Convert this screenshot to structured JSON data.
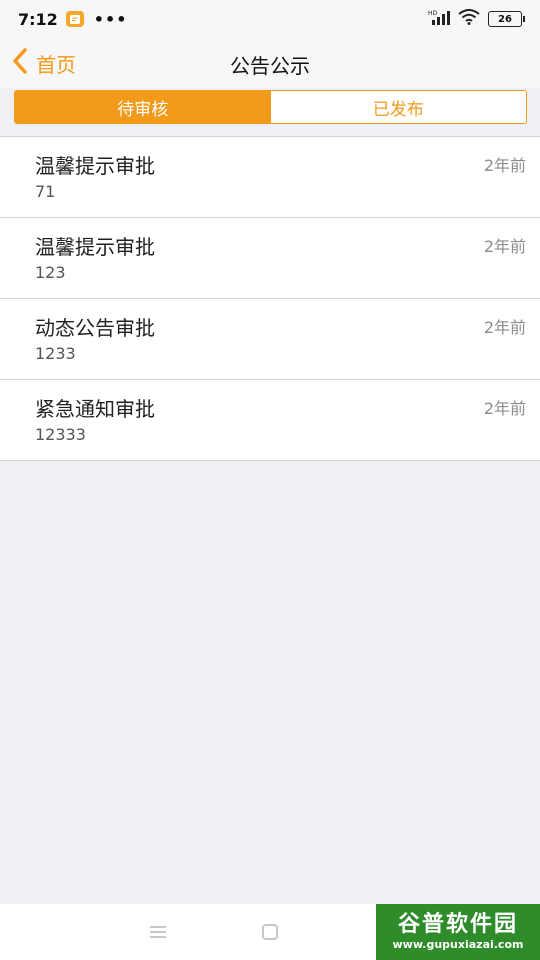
{
  "status_bar": {
    "time": "7:12",
    "dots": "•••",
    "battery": "26"
  },
  "nav": {
    "back_label": "首页",
    "title": "公告公示"
  },
  "tabs": [
    {
      "label": "待审核",
      "active": true
    },
    {
      "label": "已发布",
      "active": false
    }
  ],
  "items": [
    {
      "title": "温馨提示审批",
      "subtitle": "71",
      "time": "2年前"
    },
    {
      "title": "温馨提示审批",
      "subtitle": "123",
      "time": "2年前"
    },
    {
      "title": "动态公告审批",
      "subtitle": "1233",
      "time": "2年前"
    },
    {
      "title": "紧急通知审批",
      "subtitle": "12333",
      "time": "2年前"
    }
  ],
  "watermark": {
    "title": "谷普软件园",
    "url": "www.gupuxiazai.com"
  },
  "colors": {
    "accent": "#f39a1b",
    "background": "#f0eff4"
  }
}
